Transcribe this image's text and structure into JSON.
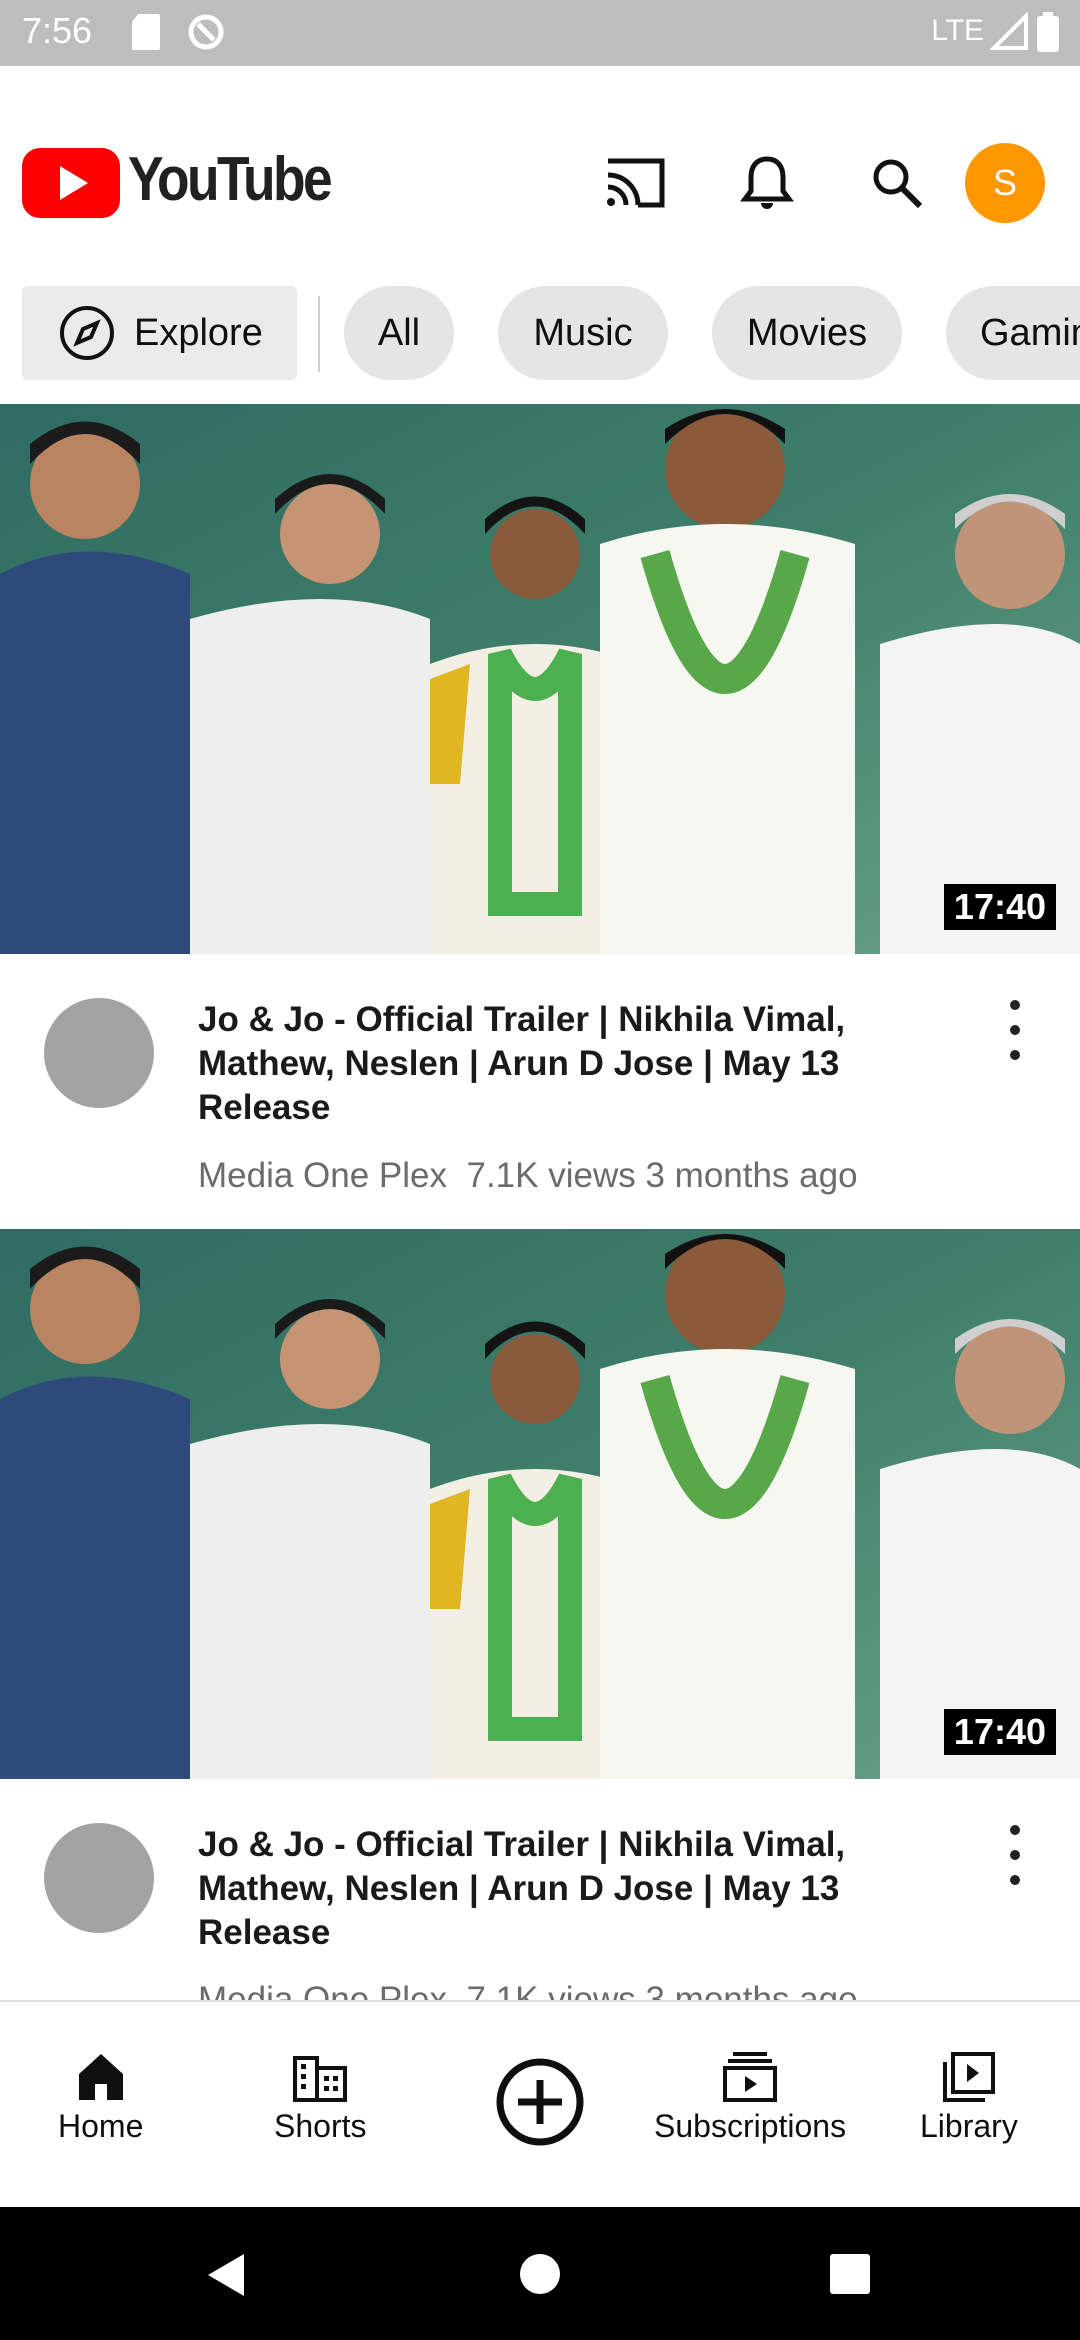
{
  "status_bar": {
    "time": "7:56",
    "network": "LTE"
  },
  "header": {
    "logo_text": "YouTube",
    "avatar_letter": "S"
  },
  "chips": [
    "Explore",
    "All",
    "Music",
    "Movies",
    "Gamin"
  ],
  "videos": [
    {
      "title": "Jo & Jo - Official Trailer | Nikhila Vimal, Mathew, Neslen | Arun D Jose | May 13 Release",
      "channel": "Media One Plex",
      "views": "7.1K views",
      "age": "3 months ago",
      "duration": "17:40"
    },
    {
      "title": "Jo & Jo - Official Trailer | Nikhila Vimal, Mathew, Neslen | Arun D Jose | May 13 Release",
      "channel": "Media One Plex",
      "views": "7.1K views",
      "age": "3 months ago",
      "duration": "17:40"
    }
  ],
  "bottom_nav": {
    "items": [
      "Home",
      "Shorts",
      "Subscriptions",
      "Library"
    ],
    "create_icon": "add-circle-icon"
  },
  "colors": {
    "brand_red": "#ff0000",
    "avatar_orange": "#ff9800"
  }
}
